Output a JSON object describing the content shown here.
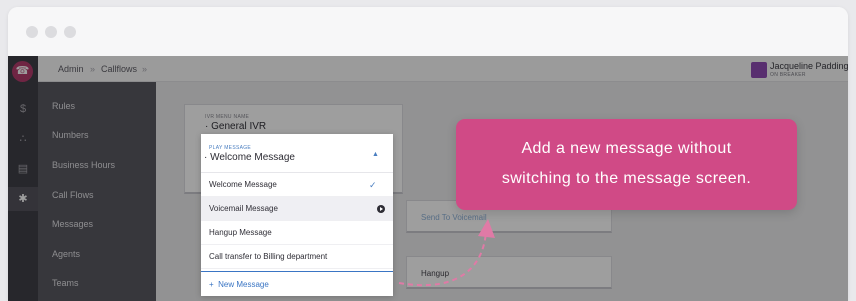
{
  "nav": {
    "items": [
      {
        "label": "Rules"
      },
      {
        "label": "Numbers"
      },
      {
        "label": "Business Hours"
      },
      {
        "label": "Call Flows"
      },
      {
        "label": "Messages"
      },
      {
        "label": "Agents"
      },
      {
        "label": "Teams"
      }
    ]
  },
  "breadcrumb": {
    "items": [
      "Admin",
      "Callflows"
    ],
    "separator": "»"
  },
  "user": {
    "name": "Jacqueline Paddington",
    "status": "ON BREAKER"
  },
  "ivr": {
    "label": "IVR MENU NAME",
    "value": "General IVR"
  },
  "play_message": {
    "label": "PLAY MESSAGE",
    "selected": "Welcome Message",
    "options": [
      {
        "label": "Welcome Message",
        "selected": true
      },
      {
        "label": "Voicemail Message",
        "hover": true
      },
      {
        "label": "Hangup Message"
      },
      {
        "label": "Call transfer to Billing department"
      }
    ],
    "new_label": "New Message"
  },
  "nodes": {
    "voicemail": "Send To Voicemail",
    "hangup": "Hangup"
  },
  "tooltip": {
    "line1": "Add a new message without",
    "line2": "switching to the message screen."
  },
  "colors": {
    "accent": "#d04a86",
    "brand": "#b43c6d",
    "link": "#3a75c4"
  },
  "icons": {
    "logo": "phone-icon",
    "rail": [
      "dollar-icon",
      "team-icon",
      "message-icon",
      "gear-icon"
    ],
    "check": "check-icon",
    "play": "play-icon",
    "caret": "caret-up-icon"
  }
}
